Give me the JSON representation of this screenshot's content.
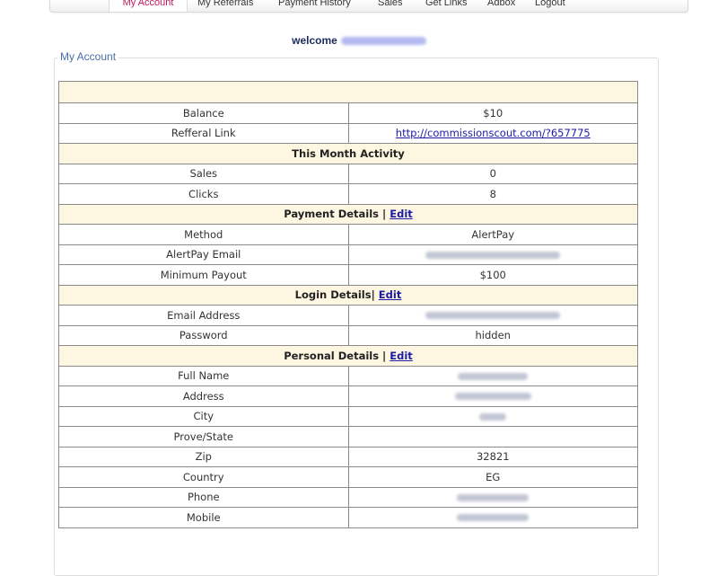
{
  "nav": {
    "items": [
      {
        "label": "My Account",
        "active": true
      },
      {
        "label": "My Referrals"
      },
      {
        "label": "Payment History"
      },
      {
        "label": "Sales"
      },
      {
        "label": "Get Links"
      },
      {
        "label": "Adbox"
      },
      {
        "label": "Logout"
      }
    ]
  },
  "welcome": {
    "text": "welcome"
  },
  "section": {
    "legend": "My Account"
  },
  "account": {
    "balance_label": "Balance",
    "balance_value": "$10",
    "referral_label": "Refferal Link",
    "referral_value": "http://commissionscout.com/?657775"
  },
  "month": {
    "header": "This Month Activity",
    "sales_label": "Sales",
    "sales_value": "0",
    "clicks_label": "Clicks",
    "clicks_value": "8"
  },
  "payment": {
    "header": "Payment Details | ",
    "edit": "Edit",
    "method_label": "Method",
    "method_value": "AlertPay",
    "email_label": "AlertPay Email",
    "min_label": "Minimum Payout",
    "min_value": "$100"
  },
  "login": {
    "header": "Login Details| ",
    "edit": "Edit",
    "email_label": "Email Address",
    "password_label": "Password",
    "password_value": "hidden"
  },
  "personal": {
    "header": "Personal Details | ",
    "edit": "Edit",
    "fullname_label": "Full Name",
    "address_label": "Address",
    "city_label": "City",
    "state_label": "Prove/State",
    "zip_label": "Zip",
    "zip_value": "32821",
    "country_label": "Country",
    "country_value": "EG",
    "phone_label": "Phone",
    "mobile_label": "Mobile"
  }
}
